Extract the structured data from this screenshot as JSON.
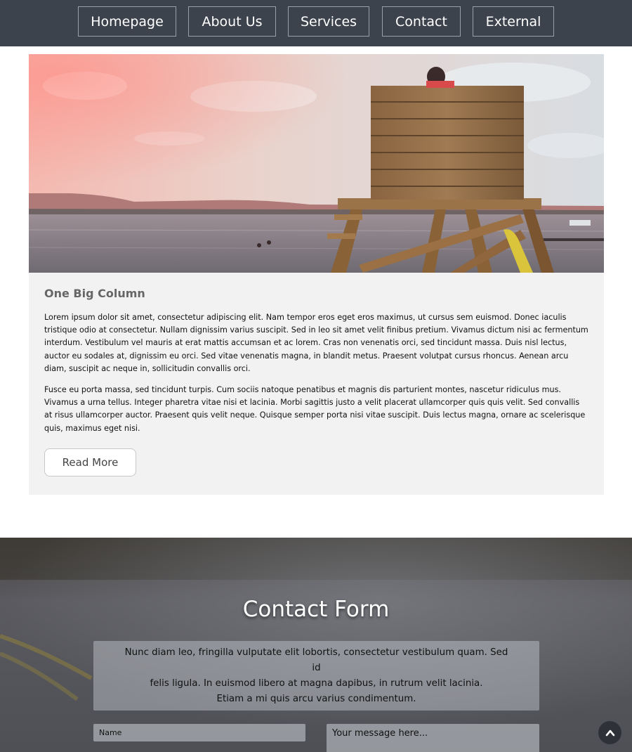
{
  "nav": {
    "items": [
      {
        "label": "Homepage"
      },
      {
        "label": "About Us"
      },
      {
        "label": "Services"
      },
      {
        "label": "Contact"
      },
      {
        "label": "External"
      }
    ]
  },
  "hero": {
    "image": "lifeguard-tower-lake-photo"
  },
  "column": {
    "title": "One Big Column",
    "paragraph1": "Lorem ipsum dolor sit amet, consectetur adipiscing elit. Nam tempor eros eget eros maximus, ut cursus sem euismod. Donec iaculis tristique odio at consectetur. Nullam dignissim varius suscipit. Sed in leo sit amet velit finibus pretium. Vivamus dictum nisi ac fermentum interdum. Vestibulum vel mauris at erat mattis accumsan et ac lorem. Cras non venenatis orci, sed tincidunt massa. Duis nisl lectus, auctor eu sodales at, dignissim eu orci. Sed vitae venenatis magna, in blandit metus. Praesent volutpat cursus rhoncus. Aenean arcu diam, suscipit ac neque in, sollicitudin convallis orci.",
    "paragraph2": "Fusce eu porta massa, sed tincidunt turpis. Cum sociis natoque penatibus et magnis dis parturient montes, nascetur ridiculus mus. Vivamus a urna tellus. Integer pharetra vitae nisi et lacinia. Morbi sagittis justo a velit placerat ullamcorper quis quis velit. Sed convallis at risus ullamcorper auctor. Praesent quis velit neque. Quisque semper porta nisi vitae suscipit. Duis lectus magna, ornare ac scelerisque quis, maximus eget nisi.",
    "read_more_label": "Read More"
  },
  "contact": {
    "title": "Contact Form",
    "intro_line1": "Nunc diam leo, fringilla vulputate elit lobortis, consectetur vestibulum quam. Sed id",
    "intro_line2": "felis ligula. In euismod libero at magna dapibus, in rutrum velit lacinia.",
    "intro_line3": "Etiam a mi quis arcu varius condimentum.",
    "name_placeholder": "Name",
    "message_placeholder": "Your message here..."
  },
  "icons": {
    "back_to_top": "chevron-up-icon"
  },
  "colors": {
    "nav_bg": "#3d434d",
    "panel_bg": "#f2f2f2",
    "title_gray": "#666666"
  }
}
